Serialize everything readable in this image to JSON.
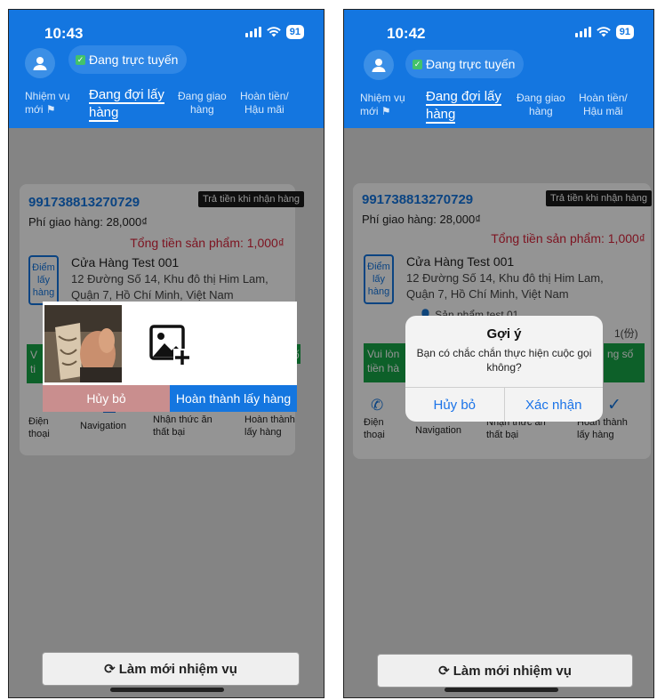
{
  "common": {
    "online_status": "Đang trực tuyến",
    "battery": "91",
    "tabs": {
      "new_line1": "Nhiệm vụ",
      "new_line2": "mới",
      "waiting_line1": "Đang đợi lấy",
      "waiting_line2": "hàng",
      "delivering_line1": "Đang giao",
      "delivering_line2": "hàng",
      "refund_line1": "Hoàn tiền/",
      "refund_line2": "Hậu mãi"
    },
    "order": {
      "id": "991738813270729",
      "cod_badge": "Trả tiền khi nhận hàng",
      "shipping_fee": "Phí giao hàng: 28,000₫",
      "total": "Tổng tiền sản phẩm: 1,000₫",
      "pickup_tag_line1": "Điểm",
      "pickup_tag_line2": "lấy",
      "pickup_tag_line3": "hàng",
      "store_name": "Cửa Hàng Test 001",
      "address_line1": "12 Đường Số 14, Khu đô thị Him Lam,",
      "address_line2": "Quận 7, Hồ Chí Minh, Việt Nam",
      "product_name": "Sản phẩm test 01",
      "product_qty": "1(份)"
    },
    "actions": {
      "phone_line1": "Điện",
      "phone_line2": "thoại",
      "navigation": "Navigation",
      "fail_line1": "Nhận thức ăn",
      "fail_line2": "thất bại",
      "done_line1": "Hoàn thành",
      "done_line2": "lấy hàng"
    },
    "refresh_button": "Làm mới nhiệm vụ"
  },
  "left": {
    "time": "10:43",
    "green_left_line1": "V",
    "green_left_line2": "ti",
    "green_right": "ố",
    "photo_modal": {
      "cancel": "Hủy bỏ",
      "confirm": "Hoàn thành lấy hàng"
    }
  },
  "right": {
    "time": "10:42",
    "green_left_line1": "Vui lòn",
    "green_left_line2": "tiền hà",
    "green_right": "ng số",
    "alert": {
      "title": "Gợi ý",
      "message": "Bạn có chắc chắn thực hiện cuộc gọi không?",
      "cancel": "Hủy bỏ",
      "confirm": "Xác nhận"
    }
  },
  "colors": {
    "header_blue": "#1476e0",
    "total_red": "#d7243a",
    "green_notice": "#18a548"
  }
}
